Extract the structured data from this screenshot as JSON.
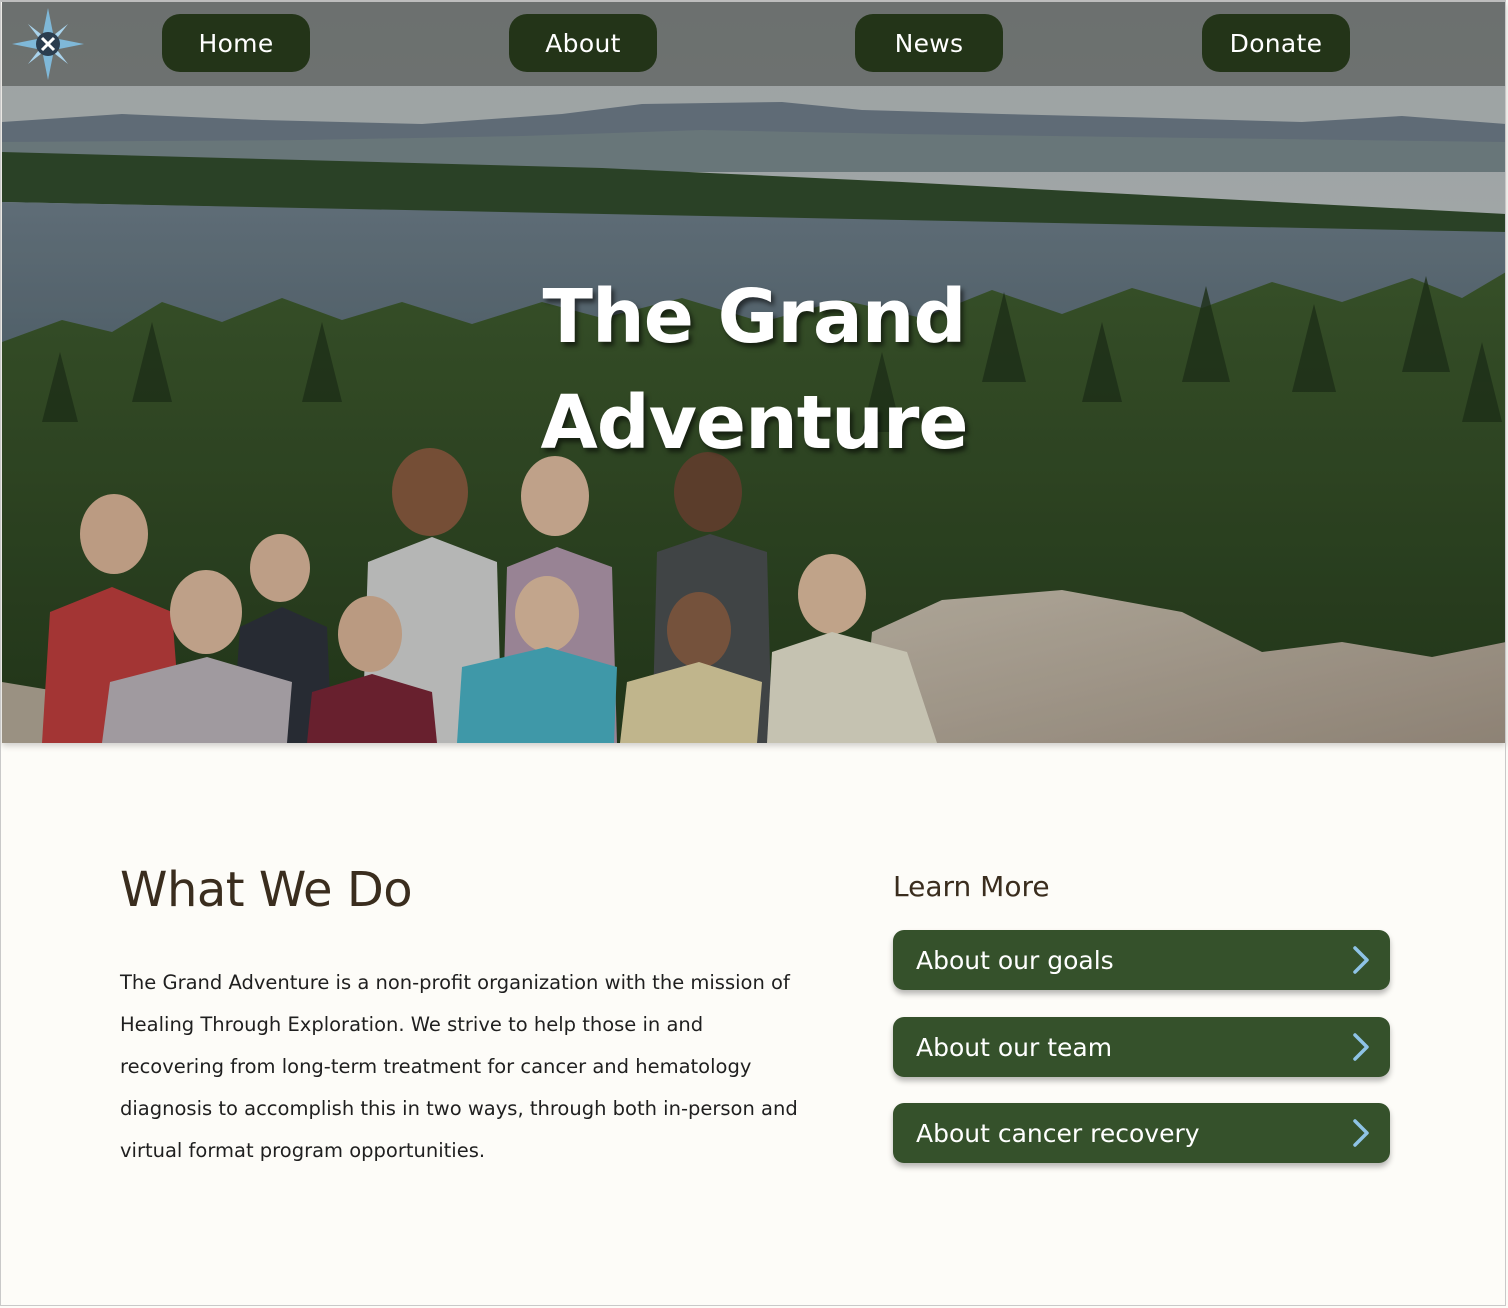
{
  "nav": {
    "logo_icon": "compass-rose-icon",
    "items": [
      {
        "label": "Home"
      },
      {
        "label": "About"
      },
      {
        "label": "News"
      },
      {
        "label": "Donate"
      }
    ]
  },
  "hero": {
    "title_line1": "The Grand",
    "title_line2": "Adventure",
    "background": "group-photo-lake-forest"
  },
  "what_we_do": {
    "title": "What We Do",
    "body": "The Grand Adventure is a non-profit organization with the mission of Healing Through Exploration. We strive to help those in and recovering from long-term treatment for cancer and hematology diagnosis to accomplish this in two ways, through both in-person and virtual format program opportunities."
  },
  "learn_more": {
    "title": "Learn More",
    "links": [
      {
        "label": "About our goals",
        "icon": "chevron-right-icon"
      },
      {
        "label": "About our team",
        "icon": "chevron-right-icon"
      },
      {
        "label": "About cancer recovery",
        "icon": "chevron-right-icon"
      }
    ]
  },
  "colors": {
    "nav_button": "#233418",
    "learn_button": "#35512b",
    "chevron": "#8ec3e6",
    "heading": "#3a2d1e",
    "background": "#fdfcf8"
  }
}
